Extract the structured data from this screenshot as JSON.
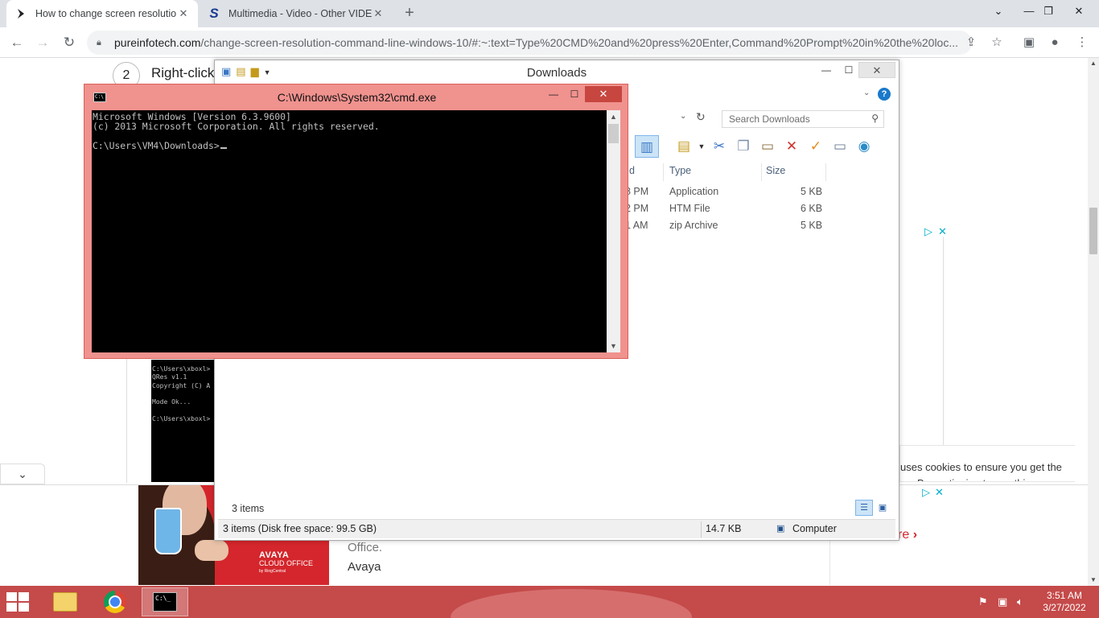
{
  "browser": {
    "tabs": [
      {
        "title": "How to change screen resolution",
        "favicon": "pureinfotech-icon"
      },
      {
        "title": "Multimedia - Video - Other VIDEO",
        "favicon": "s-logo-icon"
      }
    ],
    "new_tab": "+",
    "url_host": "pureinfotech.com",
    "url_path": "/change-screen-resolution-command-line-windows-10/#:~:text=Type%20CMD%20and%20press%20Enter,Command%20Prompt%20in%20the%20loc..."
  },
  "page": {
    "step_number": "2",
    "step_text": "Right-click",
    "code_image_text": "C:\\Users\\xboxl>\nQRes v1.1\nCopyright (C) A\n\nMode Ok...\n\nC:\\Users\\xboxl>",
    "cookie_text_1": "uses cookies to ensure you get the",
    "cookie_text_2": "ce. By continuing to use this",
    "ad": {
      "brand": "AVAYA",
      "brand_sub": "CLOUD OFFICE",
      "brand_tag": "by RingCentral",
      "line1": "Office.",
      "line2": "Avaya",
      "more": "re"
    }
  },
  "explorer": {
    "title": "Downloads",
    "search_placeholder": "Search Downloads",
    "columns": [
      {
        "label": "d"
      },
      {
        "label": "Type"
      },
      {
        "label": "Size"
      }
    ],
    "files": [
      {
        "time": "8 PM",
        "type": "Application",
        "size": "5 KB"
      },
      {
        "time": "2 PM",
        "type": "HTM File",
        "size": "6 KB"
      },
      {
        "time": "1 AM",
        "type": "zip Archive",
        "size": "5 KB"
      }
    ],
    "items_count": "3 items",
    "status_items": "3 items (Disk free space: 99.5 GB)",
    "status_size": "14.7 KB",
    "status_location": "Computer"
  },
  "cmd": {
    "title": "C:\\Windows\\System32\\cmd.exe",
    "output": "Microsoft Windows [Version 6.3.9600]\n(c) 2013 Microsoft Corporation. All rights reserved.\n\nC:\\Users\\VM4\\Downloads>"
  },
  "taskbar": {
    "time": "3:51 AM",
    "date": "3/27/2022",
    "apps": [
      "file-explorer",
      "chrome",
      "command-prompt"
    ]
  },
  "colors": {
    "taskbar": "#c54a4a",
    "cmd_frame": "#f0928e",
    "cmd_close": "#c74640",
    "adchoice": "#00aecd",
    "ad_red": "#d4262c"
  }
}
